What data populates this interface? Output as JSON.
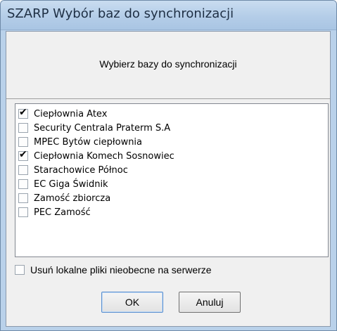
{
  "window": {
    "title": "SZARP Wybór baz do synchronizacji"
  },
  "header": {
    "label": "Wybierz bazy do synchronizacji"
  },
  "databases": [
    {
      "label": "Ciepłownia Atex",
      "checked": true
    },
    {
      "label": "Security Centrala Praterm S.A",
      "checked": false
    },
    {
      "label": "MPEC Bytów ciepłownia",
      "checked": false
    },
    {
      "label": "Ciepłownia Komech Sosnowiec",
      "checked": true
    },
    {
      "label": "Starachowice Północ",
      "checked": false
    },
    {
      "label": "EC Giga Świdnik",
      "checked": false
    },
    {
      "label": "Zamość zbiorcza",
      "checked": false
    },
    {
      "label": "PEC Zamość",
      "checked": false
    }
  ],
  "options": {
    "remove_local_label": "Usuń lokalne pliki nieobecne na serwerze",
    "remove_local_checked": false
  },
  "buttons": {
    "ok_label": "OK",
    "cancel_label": "Anuluj"
  }
}
